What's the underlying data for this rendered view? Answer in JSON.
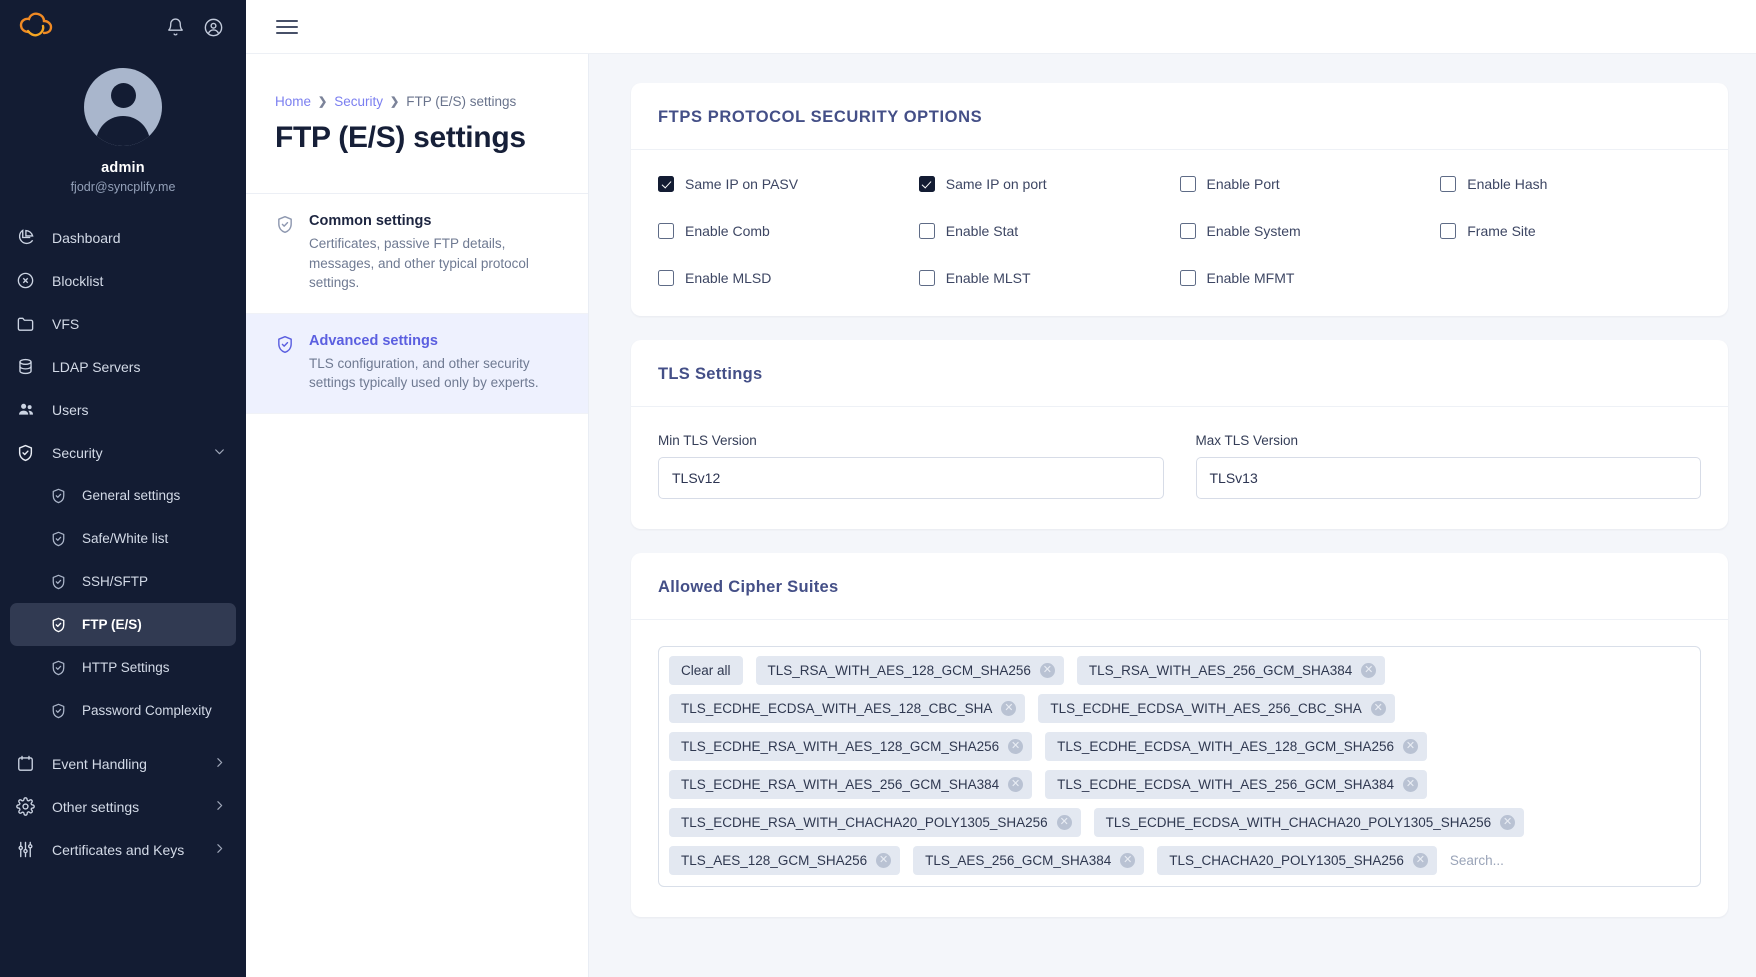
{
  "sidebar": {
    "logo_icon": "syncplify-cloud-logo",
    "logo_color": "#f08a24",
    "notifications_icon": "bell-icon",
    "account_icon": "account-circle-icon",
    "user": {
      "name": "admin",
      "email": "fjodr@syncplify.me",
      "avatar_icon": "user-avatar"
    },
    "items": [
      {
        "label": "Dashboard",
        "icon": "pie-chart-icon",
        "active": false,
        "chevron": ""
      },
      {
        "label": "Blocklist",
        "icon": "block-circle-icon",
        "active": false,
        "chevron": ""
      },
      {
        "label": "VFS",
        "icon": "folder-icon",
        "active": false,
        "chevron": ""
      },
      {
        "label": "LDAP Servers",
        "icon": "database-icon",
        "active": false,
        "chevron": ""
      },
      {
        "label": "Users",
        "icon": "users-icon",
        "active": false,
        "chevron": ""
      },
      {
        "label": "Security",
        "icon": "shield-check-icon",
        "active": false,
        "chevron": "chevron-down-icon"
      }
    ],
    "security_subitems": [
      {
        "label": "General settings",
        "icon": "shield-check-icon",
        "active": false
      },
      {
        "label": "Safe/White list",
        "icon": "shield-check-icon",
        "active": false
      },
      {
        "label": "SSH/SFTP",
        "icon": "shield-check-icon",
        "active": false
      },
      {
        "label": "FTP (E/S)",
        "icon": "shield-check-icon",
        "active": true
      },
      {
        "label": "HTTP Settings",
        "icon": "shield-check-icon",
        "active": false
      },
      {
        "label": "Password Complexity",
        "icon": "shield-check-icon",
        "active": false
      }
    ],
    "bottom_items": [
      {
        "label": "Event Handling",
        "icon": "calendar-icon",
        "chevron": "chevron-right-icon"
      },
      {
        "label": "Other settings",
        "icon": "gear-icon",
        "chevron": "chevron-right-icon"
      },
      {
        "label": "Certificates and Keys",
        "icon": "sliders-icon",
        "chevron": "chevron-right-icon"
      }
    ]
  },
  "topbar": {
    "menu_icon": "hamburger-menu-icon"
  },
  "breadcrumb": {
    "home": "Home",
    "section": "Security",
    "current": "FTP (E/S) settings",
    "separator_icon": "chevron-right-icon"
  },
  "page": {
    "title": "FTP (E/S) settings"
  },
  "settings_tiles": [
    {
      "title": "Common settings",
      "desc": "Certificates, passive FTP details, messages, and other typical protocol settings.",
      "icon": "shield-check-icon",
      "active": false
    },
    {
      "title": "Advanced settings",
      "desc": "TLS configuration, and other security settings typically used only by experts.",
      "icon": "shield-check-icon",
      "active": true
    }
  ],
  "ftps_card": {
    "title": "FTPS PROTOCOL SECURITY OPTIONS",
    "checkboxes": [
      {
        "label": "Same IP on PASV",
        "checked": true
      },
      {
        "label": "Same IP on port",
        "checked": true
      },
      {
        "label": "Enable Port",
        "checked": false
      },
      {
        "label": "Enable Hash",
        "checked": false
      },
      {
        "label": "Enable Comb",
        "checked": false
      },
      {
        "label": "Enable Stat",
        "checked": false
      },
      {
        "label": "Enable System",
        "checked": false
      },
      {
        "label": "Frame Site",
        "checked": false
      },
      {
        "label": "Enable MLSD",
        "checked": false
      },
      {
        "label": "Enable MLST",
        "checked": false
      },
      {
        "label": "Enable MFMT",
        "checked": false
      }
    ]
  },
  "tls_card": {
    "title": "TLS Settings",
    "min_label": "Min TLS Version",
    "min_value": "TLSv12",
    "max_label": "Max TLS Version",
    "max_value": "TLSv13",
    "dropdown_icon": "caret-down-icon"
  },
  "cipher_card": {
    "title": "Allowed Cipher Suites",
    "clear_all": "Clear all",
    "search_placeholder": "Search...",
    "remove_icon": "remove-circle-icon",
    "chips": [
      "TLS_RSA_WITH_AES_128_GCM_SHA256",
      "TLS_RSA_WITH_AES_256_GCM_SHA384",
      "TLS_ECDHE_ECDSA_WITH_AES_128_CBC_SHA",
      "TLS_ECDHE_ECDSA_WITH_AES_256_CBC_SHA",
      "TLS_ECDHE_RSA_WITH_AES_128_GCM_SHA256",
      "TLS_ECDHE_ECDSA_WITH_AES_128_GCM_SHA256",
      "TLS_ECDHE_RSA_WITH_AES_256_GCM_SHA384",
      "TLS_ECDHE_ECDSA_WITH_AES_256_GCM_SHA384",
      "TLS_ECDHE_RSA_WITH_CHACHA20_POLY1305_SHA256",
      "TLS_ECDHE_ECDSA_WITH_CHACHA20_POLY1305_SHA256",
      "TLS_AES_128_GCM_SHA256",
      "TLS_AES_256_GCM_SHA384",
      "TLS_CHACHA20_POLY1305_SHA256"
    ]
  },
  "colors": {
    "accent": "#5b5fe0",
    "sidebar_bg": "#131c33",
    "brand_orange": "#f08a24",
    "heading": "#444f87"
  }
}
